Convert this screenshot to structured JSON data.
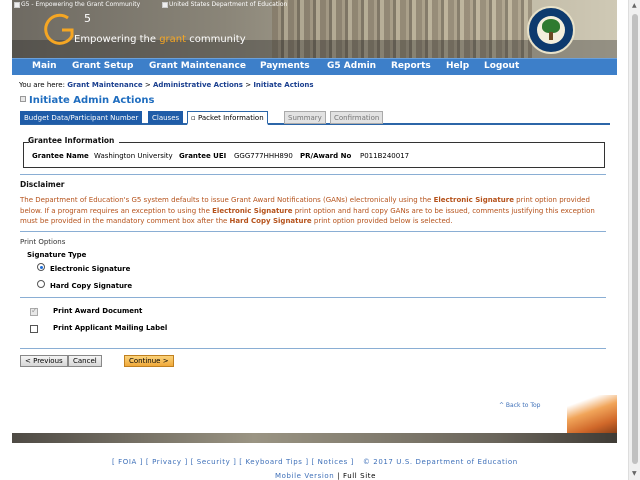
{
  "header": {
    "left_image_alt": "G5 - Empowering the Grant Community",
    "right_image_alt": "United States Department of Education",
    "logo_text": "G",
    "logo_sup": "5",
    "tagline_pre": "Empowering the ",
    "tagline_accent": "grant",
    "tagline_post": " community"
  },
  "nav": {
    "items": [
      "Main",
      "Grant Setup",
      "Grant Maintenance",
      "Payments",
      "G5 Admin",
      "Reports",
      "Help",
      "Logout"
    ]
  },
  "breadcrumb": {
    "prefix": "You are here:",
    "items": [
      "Grant Maintenance",
      "Administrative Actions",
      "Initiate Actions"
    ],
    "separator": ">"
  },
  "page": {
    "title": "Initiate Admin Actions"
  },
  "tabs": [
    {
      "label": "Budget Data/Participant Number",
      "state": "active"
    },
    {
      "label": "Clauses",
      "state": "active"
    },
    {
      "label": "Packet Information",
      "state": "current"
    },
    {
      "label": "Summary",
      "state": "disabled"
    },
    {
      "label": "Confirmation",
      "state": "disabled"
    }
  ],
  "grantee": {
    "section_title": "Grantee Information",
    "name_label": "Grantee Name",
    "name_value": "Washington University",
    "uei_label": "Grantee UEI",
    "uei_value": "GGG777HHH890",
    "award_label": "PR/Award No",
    "award_value": "P011B240017"
  },
  "disclaimer": {
    "title": "Disclaimer",
    "t1": "The Department of Education's G5 system defaults to issue Grant Award Notifications (GANs) electronically using the ",
    "b1": "Electronic Signature",
    "t2": " print option provided below. If a program requires an exception to using the ",
    "b2": "Electronic Signature",
    "t3": " print option and hard copy GANs are to be issued, comments justifying this exception must be provided in the mandatory comment box after the ",
    "b3": "Hard Copy Signature",
    "t4": " print option provided below is selected."
  },
  "print_options": {
    "title": "Print Options",
    "signature_type_label": "Signature Type",
    "electronic_label": "Electronic Signature",
    "electronic_selected": true,
    "hardcopy_label": "Hard Copy Signature",
    "hardcopy_selected": false,
    "print_award_label": "Print Award Document",
    "print_award_checked": true,
    "print_award_disabled": true,
    "print_mailing_label": "Print Applicant Mailing Label",
    "print_mailing_checked": false
  },
  "buttons": {
    "previous": "< Previous",
    "cancel": "Cancel",
    "continue": "Continue >"
  },
  "back_to_top": "^ Back to Top",
  "footer": {
    "links": [
      "FOIA",
      "Privacy",
      "Security",
      "Keyboard Tips",
      "Notices"
    ],
    "copyright": "© 2017 U.S. Department of Education",
    "mobile_label": "Mobile Version",
    "separator": "|",
    "full_site": "Full Site"
  },
  "colors": {
    "nav_bg": "#3d7fc9",
    "title_blue": "#1f6dbf",
    "disclaimer_orange": "#b5521b",
    "tab_active": "#1f5ca8",
    "continue_button": "#f0a93a"
  }
}
